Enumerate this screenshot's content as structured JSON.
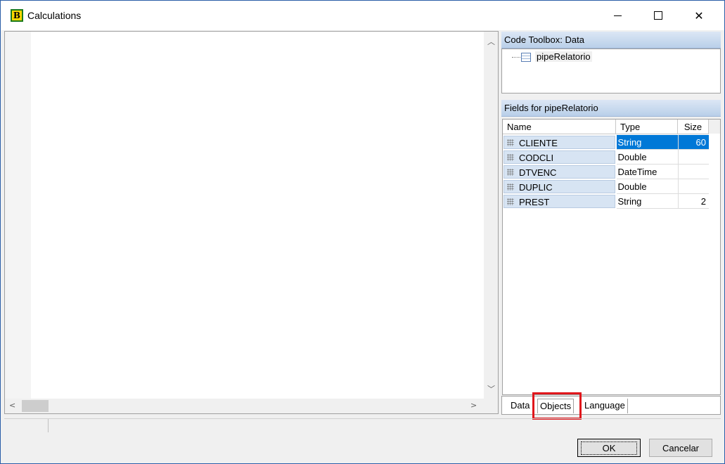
{
  "window": {
    "title": "Calculations",
    "app_logo_letter": "B"
  },
  "toolbox": {
    "header": "Code Toolbox: Data",
    "tree_item": "pipeRelatorio"
  },
  "fields": {
    "header": "Fields for pipeRelatorio",
    "columns": [
      "Name",
      "Type",
      "Size"
    ],
    "rows": [
      {
        "name": "CLIENTE",
        "type": "String",
        "size": "60"
      },
      {
        "name": "CODCLI",
        "type": "Double",
        "size": ""
      },
      {
        "name": "DTVENC",
        "type": "DateTime",
        "size": ""
      },
      {
        "name": "DUPLIC",
        "type": "Double",
        "size": ""
      },
      {
        "name": "PREST",
        "type": "String",
        "size": "2"
      }
    ]
  },
  "tabs": {
    "data": "Data",
    "objects": "Objects",
    "language": "Language"
  },
  "buttons": {
    "ok": "OK",
    "cancel": "Cancelar"
  },
  "colors": {
    "selection": "#0078d7",
    "highlight": "#e0161b",
    "panel_header": "#c9dbf0"
  }
}
